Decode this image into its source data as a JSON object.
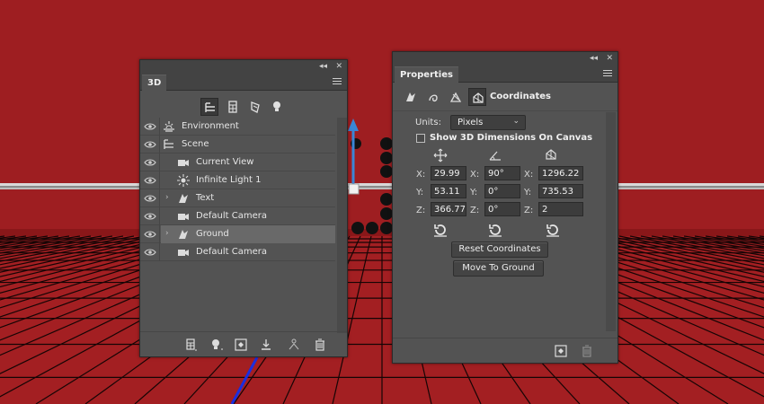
{
  "panel_3d": {
    "tab_label": "3D",
    "layers": [
      {
        "label": "Environment",
        "visible": true,
        "indent": 0,
        "expandable": false,
        "icon": "environment-icon"
      },
      {
        "label": "Scene",
        "visible": true,
        "indent": 0,
        "expandable": false,
        "icon": "scene-icon"
      },
      {
        "label": "Current View",
        "visible": true,
        "indent": 1,
        "expandable": false,
        "icon": "camera-icon"
      },
      {
        "label": "Infinite Light 1",
        "visible": true,
        "indent": 1,
        "expandable": false,
        "icon": "light-icon"
      },
      {
        "label": "Text",
        "visible": true,
        "indent": 1,
        "expandable": true,
        "icon": "mesh-icon"
      },
      {
        "label": "Default Camera",
        "visible": true,
        "indent": 1,
        "expandable": false,
        "icon": "camera-icon"
      },
      {
        "label": "Ground",
        "visible": true,
        "indent": 1,
        "expandable": true,
        "icon": "mesh-icon",
        "selected": true
      },
      {
        "label": "Default Camera",
        "visible": true,
        "indent": 1,
        "expandable": false,
        "icon": "camera-icon"
      }
    ]
  },
  "panel_properties": {
    "tab_label": "Properties",
    "section_title": "Coordinates",
    "units_label": "Units:",
    "units_value": "Pixels",
    "show_dimensions_label": "Show 3D Dimensions On Canvas",
    "show_dimensions_checked": false,
    "position": {
      "x": "29.99",
      "y": "53.11",
      "z": "366.77"
    },
    "rotation": {
      "x": "90°",
      "y": "0°",
      "z": "0°"
    },
    "scale": {
      "x": "1296.22",
      "y": "735.53",
      "z": "2"
    },
    "axis_labels": {
      "x": "X:",
      "y": "Y:",
      "z": "Z:"
    },
    "reset_button": "Reset Coordinates",
    "move_button": "Move To Ground"
  },
  "colors": {
    "background": "#9e1e21",
    "panel": "#535353",
    "selected_row": "#696969",
    "axis_blue": "#3a86d6"
  }
}
